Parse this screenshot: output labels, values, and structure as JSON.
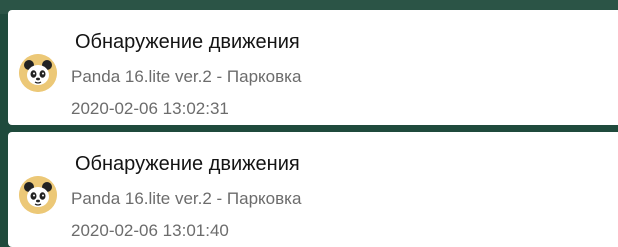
{
  "notifications": [
    {
      "title": "Обнаружение движения",
      "subtitle": "Panda 16.lite ver.2 - Парковка",
      "time": "2020-02-06 13:02:31",
      "avatar_icon": "panda-icon"
    },
    {
      "title": "Обнаружение движения",
      "subtitle": "Panda 16.lite ver.2 - Парковка",
      "time": "2020-02-06 13:01:40",
      "avatar_icon": "panda-icon"
    }
  ],
  "colors": {
    "background": "#1f4a3c",
    "card": "#ffffff",
    "avatar_bg": "#ecc877",
    "title_text": "#141414",
    "secondary_text": "#6c6c6c"
  }
}
